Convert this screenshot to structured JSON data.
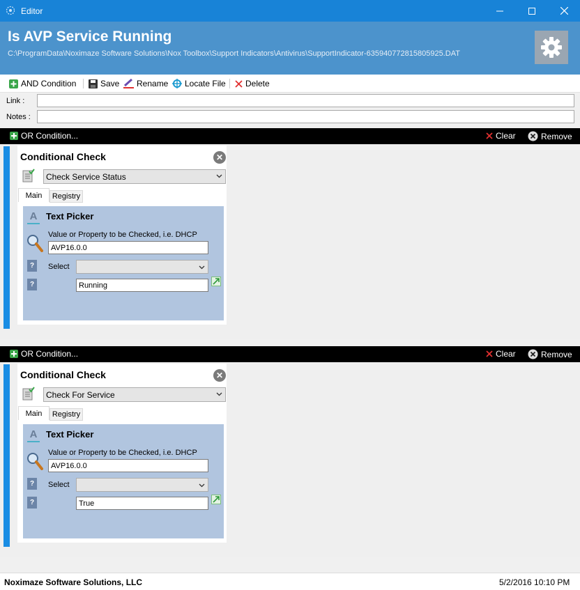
{
  "window": {
    "title": "Editor"
  },
  "header": {
    "title": "Is AVP Service Running",
    "path": "C:\\ProgramData\\Noximaze Software Solutions\\Nox Toolbox\\Support Indicators\\Antivirus\\SupportIndicator-635940772815805925.DAT"
  },
  "toolbar": {
    "and_condition": "AND Condition",
    "save": "Save",
    "rename": "Rename",
    "locate_file": "Locate File",
    "delete": "Delete"
  },
  "fields": {
    "link_label": "Link :",
    "link_value": "",
    "notes_label": "Notes :",
    "notes_value": ""
  },
  "or_conditions": [
    {
      "label": "OR Condition...",
      "clear": "Clear",
      "remove": "Remove",
      "check": {
        "title": "Conditional Check",
        "type": "Check Service Status",
        "tabs": [
          "Main",
          "Registry"
        ],
        "picker": {
          "title": "Text Picker",
          "value_label": "Value or Property to be Checked, i.e. DHCP",
          "value": "AVP16.0.0",
          "select_label": "Select",
          "select_value": "",
          "compare_value": "Running"
        }
      }
    },
    {
      "label": "OR Condition...",
      "clear": "Clear",
      "remove": "Remove",
      "check": {
        "title": "Conditional Check",
        "type": "Check For Service",
        "tabs": [
          "Main",
          "Registry"
        ],
        "picker": {
          "title": "Text Picker",
          "value_label": "Value or Property to be Checked, i.e. DHCP",
          "value": "AVP16.0.0",
          "select_label": "Select",
          "select_value": "",
          "compare_value": "True"
        }
      }
    }
  ],
  "footer": {
    "company": "Noximaze Software Solutions, LLC",
    "datetime": "5/2/2016 10:10 PM"
  },
  "colors": {
    "titlebar": "#1883d7",
    "header": "#4c93cc",
    "accent_strip": "#1a8de4",
    "picker_panel": "#b1c5df"
  }
}
